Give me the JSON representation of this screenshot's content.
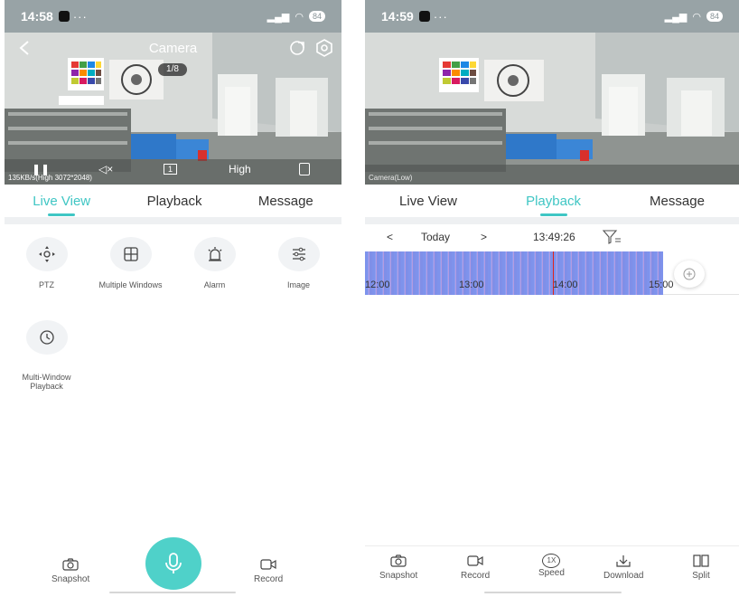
{
  "left": {
    "status": {
      "time": "14:58",
      "dots": "···",
      "battery": "84"
    },
    "header": {
      "title": "Camera"
    },
    "video": {
      "counter": "1/8",
      "bitrate": "135KB/s(High 3072*2048)",
      "channel": "1",
      "quality": "High"
    },
    "tabs": [
      {
        "label": "Live View"
      },
      {
        "label": "Playback"
      },
      {
        "label": "Message"
      }
    ],
    "features": [
      {
        "label": "PTZ",
        "icon": "ptz-icon"
      },
      {
        "label": "Multiple Windows",
        "icon": "grid-icon"
      },
      {
        "label": "Alarm",
        "icon": "alarm-icon"
      },
      {
        "label": "Image",
        "icon": "sliders-icon"
      },
      {
        "label": "Multi-Window\nPlayback",
        "icon": "history-icon"
      }
    ],
    "bottom": {
      "snapshot": "Snapshot",
      "record": "Record"
    }
  },
  "right": {
    "status": {
      "time": "14:59",
      "dots": "···",
      "battery": "84"
    },
    "video": {
      "label": "Camera(Low)"
    },
    "tabs": [
      {
        "label": "Live View"
      },
      {
        "label": "Playback"
      },
      {
        "label": "Message"
      }
    ],
    "playbar": {
      "prev": "<",
      "date": "Today",
      "next": ">",
      "time": "13:49:26"
    },
    "timeline": {
      "labels": [
        "12:00",
        "13:00",
        "14:00",
        "15:00"
      ]
    },
    "bottom": {
      "snapshot": "Snapshot",
      "record": "Record",
      "speed": "Speed",
      "speed_badge": "1X",
      "download": "Download",
      "split": "Split"
    }
  },
  "colors": {
    "accent": "#3fc6c4",
    "timeline": "#7e93ec",
    "cursor": "#e2231a"
  }
}
